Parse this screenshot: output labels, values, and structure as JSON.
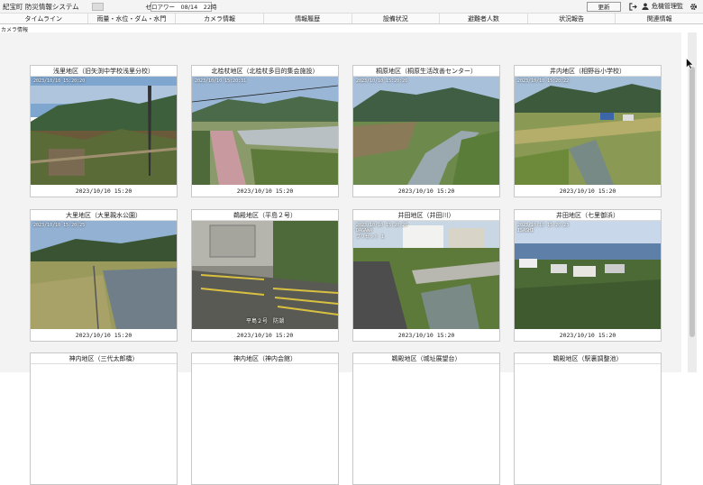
{
  "header": {
    "title": "紀宝町 防災情報システム",
    "status": "ゼロアワー　08/14　22時",
    "refresh_label": "更新",
    "user_name": "危機管理監"
  },
  "nav": {
    "items": [
      {
        "label": "タイムライン"
      },
      {
        "label": "雨量・水位・ダム・水門"
      },
      {
        "label": "カメラ情報"
      },
      {
        "label": "情報履歴"
      },
      {
        "label": "設備状況"
      },
      {
        "label": "避難者人数"
      },
      {
        "label": "状況報告"
      },
      {
        "label": "関連情報"
      }
    ]
  },
  "section_label": "カメラ情報",
  "cameras": [
    {
      "title": "浅里地区（旧矢渕中学校浅里分校）",
      "date": "2023/10/10 15:20",
      "overlay": "2023/10/10 15:20:20"
    },
    {
      "title": "北桧杖地区（北桧杖多目的集会施設）",
      "date": "2023/10/10 15:20",
      "overlay": "2023/10/10 15:20:31"
    },
    {
      "title": "桐原地区（桐原生活改善センター）",
      "date": "2023/10/10 15:20",
      "overlay": "2023/10/10 15:20:26"
    },
    {
      "title": "井内地区（相野谷小学校）",
      "date": "2023/10/10 15:20",
      "overlay": "2023/10/10 15:20:22"
    },
    {
      "title": "大里地区（大里親水公園）",
      "date": "2023/10/10 15:20",
      "overlay": "2023/10/10 15:20:25"
    },
    {
      "title": "鵜殿地区（平島２号）",
      "date": "2023/10/10 15:20",
      "overlay": "",
      "caption": "平島２号　防潮"
    },
    {
      "title": "井田地区（井田川）",
      "date": "2023/10/10 15:20",
      "overlay": "2023/10/10 15:20:26",
      "overlay2": "DAGAWA",
      "overlay3": "プリセット 1"
    },
    {
      "title": "井田地区（七里御浜）",
      "date": "2023/10/10 15:20",
      "overlay": "2023/10/10 15:20:23",
      "overlay2": "ISASHI"
    },
    {
      "title": "神内地区（三代太郎橋）",
      "date": ""
    },
    {
      "title": "神内地区（神内会館）",
      "date": ""
    },
    {
      "title": "鵜殿地区（城址展望台）",
      "date": ""
    },
    {
      "title": "鵜殿地区（駅裏調整池）",
      "date": ""
    }
  ],
  "colors": {
    "header_bg": "#f4f4f4",
    "content_bg": "#f3f3f3",
    "card_border": "#c8c8c8"
  },
  "icons": [
    "logout-icon",
    "user-icon",
    "gear-icon",
    "mouse-cursor-icon"
  ]
}
